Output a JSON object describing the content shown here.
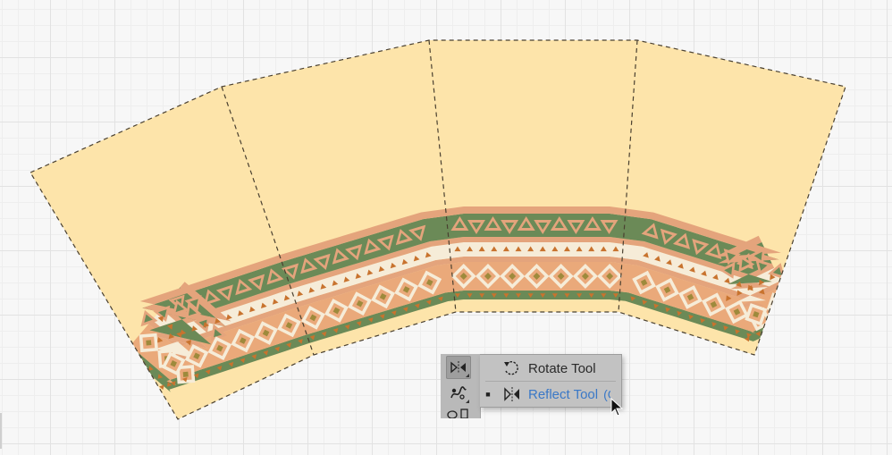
{
  "canvas": {
    "background_color": "#f7f7f7",
    "grid_color": "#e2e2e2"
  },
  "artwork": {
    "panel_fill": "#fde4aa",
    "cut_line_color": "#4a4030",
    "border_colors": {
      "salmon": "#e4a47c",
      "green": "#6b8a57",
      "cream": "#f6ecd8",
      "peach": "#eaa97a",
      "orange": "#c8732e",
      "olive": "#9e8a3c"
    },
    "panel_count": 4
  },
  "toolbar": {
    "active_tool_icon": "reflect-tool-icon",
    "secondary_tool_icon": "puppet-warp-icon"
  },
  "flyout": {
    "items": [
      {
        "label": "Rotate Tool",
        "icon": "rotate-tool-icon",
        "shortcut": "",
        "selected": false
      },
      {
        "label": "Reflect Tool",
        "icon": "reflect-tool-icon",
        "shortcut": "(O)",
        "selected": true
      }
    ],
    "highlight_color": "#3a78c7"
  },
  "cursor": {
    "icon": "arrow-cursor-icon"
  }
}
